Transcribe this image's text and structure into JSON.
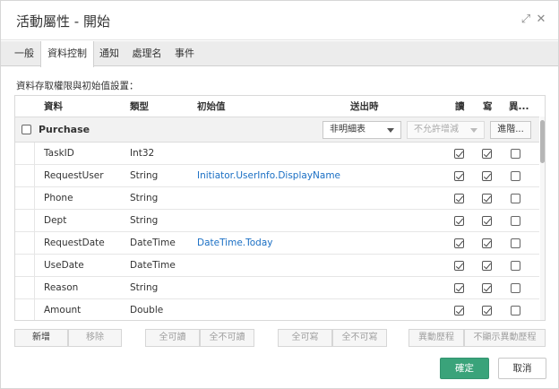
{
  "window": {
    "title": "活動屬性 - 開始",
    "expand_icon": "expand-icon",
    "close_icon": "close-icon"
  },
  "tabs": [
    {
      "label": "一般",
      "active": false
    },
    {
      "label": "資料控制",
      "active": true
    },
    {
      "label": "通知",
      "active": false
    },
    {
      "label": "處理名",
      "active": false
    },
    {
      "label": "事件",
      "active": false
    }
  ],
  "section_label": "資料存取權限與初始值設置：",
  "table": {
    "headers": {
      "data": "資料",
      "type": "類型",
      "initial": "初始值",
      "send": "送出時",
      "read": "讀",
      "write": "寫",
      "change": "異..."
    },
    "group": {
      "name": "Purchase",
      "send_select": "非明細表",
      "send_select2": "不允許增減",
      "advanced_label": "進階..."
    },
    "rows": [
      {
        "name": "TaskID",
        "type": "Int32",
        "initial": "",
        "read": true,
        "write": true,
        "change": false
      },
      {
        "name": "RequestUser",
        "type": "String",
        "initial": "Initiator.UserInfo.DisplayName",
        "read": true,
        "write": true,
        "change": false
      },
      {
        "name": "Phone",
        "type": "String",
        "initial": "",
        "read": true,
        "write": true,
        "change": false
      },
      {
        "name": "Dept",
        "type": "String",
        "initial": "",
        "read": true,
        "write": true,
        "change": false
      },
      {
        "name": "RequestDate",
        "type": "DateTime",
        "initial": "DateTime.Today",
        "read": true,
        "write": true,
        "change": false
      },
      {
        "name": "UseDate",
        "type": "DateTime",
        "initial": "",
        "read": true,
        "write": true,
        "change": false
      },
      {
        "name": "Reason",
        "type": "String",
        "initial": "",
        "read": true,
        "write": true,
        "change": false
      },
      {
        "name": "Amount",
        "type": "Double",
        "initial": "",
        "read": true,
        "write": true,
        "change": false
      }
    ]
  },
  "bottom_buttons": {
    "add": "新增",
    "remove": "移除",
    "all_read": "全可讀",
    "none_read": "全不可讀",
    "all_write": "全可寫",
    "none_write": "全不可寫",
    "change_history": "異動歷程",
    "hide_change_history": "不顯示異動歷程"
  },
  "footer": {
    "ok": "確定",
    "cancel": "取消"
  },
  "colors": {
    "ok_button": "#3aa37a",
    "link_text": "#1a6fc4"
  }
}
